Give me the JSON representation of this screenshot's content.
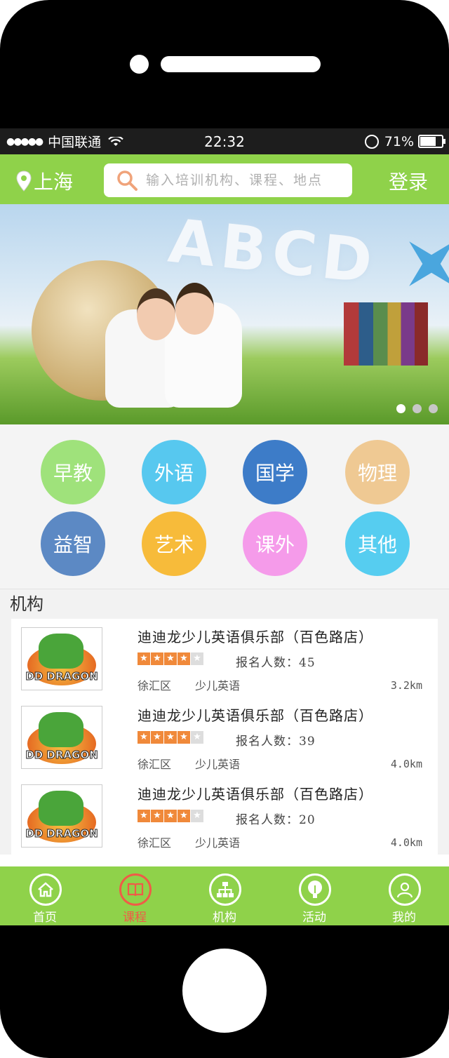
{
  "status_bar": {
    "signal": "●●●●●",
    "carrier": "中国联通",
    "time": "22:32",
    "battery_text": "71%"
  },
  "header": {
    "city": "上海",
    "search_placeholder": "输入培训机构、课程、地点",
    "login_label": "登录"
  },
  "banner": {
    "headline_letters": "ABCD",
    "dots": 3,
    "active_dot": 0
  },
  "categories": [
    {
      "label": "早教",
      "color": "#9fe27b"
    },
    {
      "label": "外语",
      "color": "#57c8ef"
    },
    {
      "label": "国学",
      "color": "#3d7cc8"
    },
    {
      "label": "物理",
      "color": "#efc993"
    },
    {
      "label": "益智",
      "color": "#5c89c4"
    },
    {
      "label": "艺术",
      "color": "#f7bb3a"
    },
    {
      "label": "课外",
      "color": "#f59bea"
    },
    {
      "label": "其他",
      "color": "#56cdf0"
    }
  ],
  "section": {
    "title": "机构"
  },
  "institutions": [
    {
      "logo_text": "DD DRAGON",
      "name": "迪迪龙少儿英语俱乐部（百色路店）",
      "rating": 4,
      "signup": "报名人数：45",
      "district": "徐汇区",
      "tag": "少儿英语",
      "distance": "3.2km"
    },
    {
      "logo_text": "DD DRAGON",
      "name": "迪迪龙少儿英语俱乐部（百色路店）",
      "rating": 4,
      "signup": "报名人数：39",
      "district": "徐汇区",
      "tag": "少儿英语",
      "distance": "4.0km"
    },
    {
      "logo_text": "DD DRAGON",
      "name": "迪迪龙少儿英语俱乐部（百色路店）",
      "rating": 4,
      "signup": "报名人数：20",
      "district": "徐汇区",
      "tag": "少儿英语",
      "distance": "4.0km"
    }
  ],
  "tabs": [
    {
      "label": "首页",
      "icon": "home-icon",
      "active": false
    },
    {
      "label": "课程",
      "icon": "book-icon",
      "active": true
    },
    {
      "label": "机构",
      "icon": "org-chart-icon",
      "active": false
    },
    {
      "label": "活动",
      "icon": "lightbulb-icon",
      "active": false
    },
    {
      "label": "我的",
      "icon": "user-icon",
      "active": false
    }
  ],
  "colors": {
    "brand_green": "#8fd24a",
    "active_tab": "#f05b47",
    "star": "#f0893a"
  }
}
